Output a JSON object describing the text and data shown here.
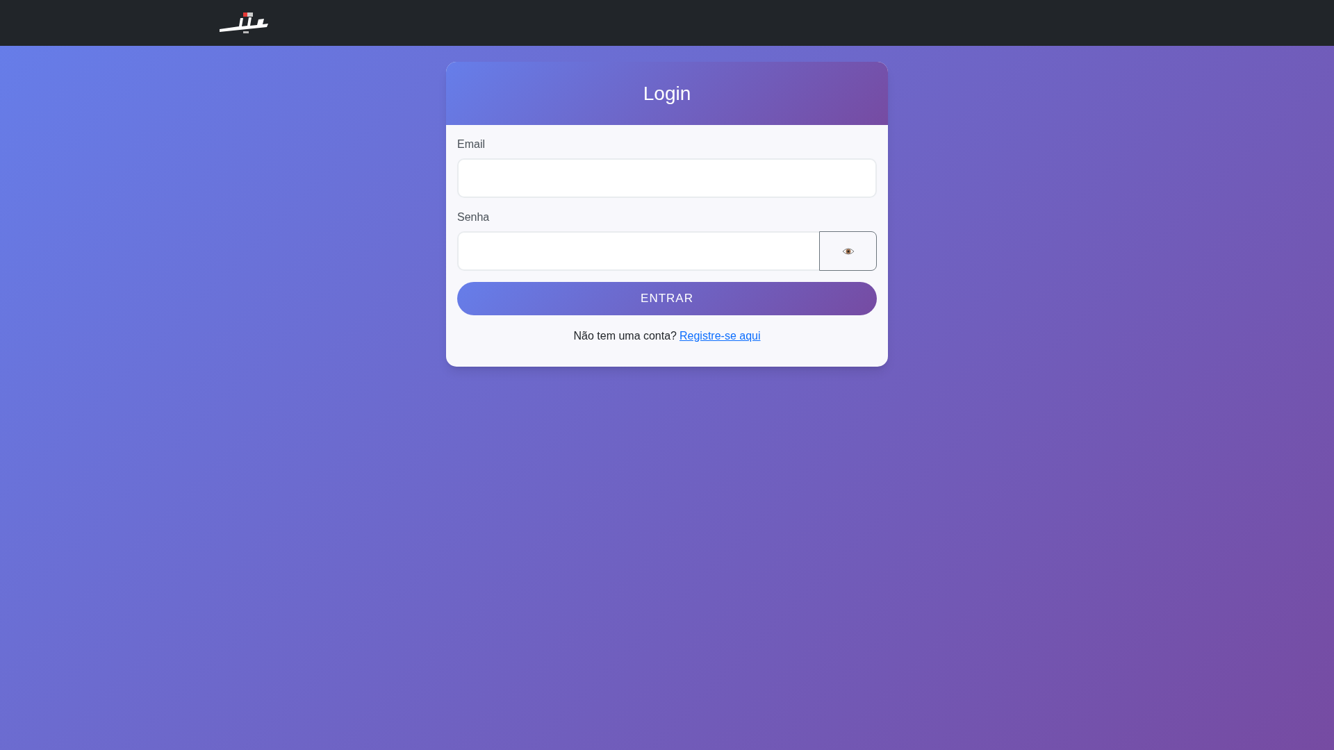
{
  "card": {
    "title": "Login"
  },
  "fields": [
    {
      "label": "Email",
      "kind": "text"
    },
    {
      "label": "Senha",
      "kind": "password"
    }
  ],
  "submit": {
    "label": "ENTRAR"
  },
  "footer": {
    "text": "Não tem uma conta?",
    "link": "Registre-se aqui"
  }
}
